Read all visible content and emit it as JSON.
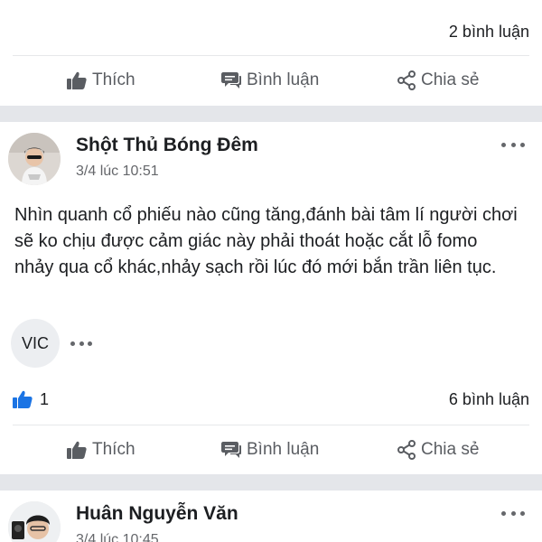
{
  "previous_post": {
    "comments": "2 bình luận",
    "actions": {
      "like": "Thích",
      "comment": "Bình luận",
      "share": "Chia sẻ"
    }
  },
  "post": {
    "author": "Shột Thủ Bóng Đêm",
    "time": "3/4 lúc 10:51",
    "text": "Nhìn quanh cổ phiếu nào cũng tăng,đánh bài tâm lí người chơi sẽ ko chịu được cảm giác này phải thoát hoặc cắt lỗ fomo nhảy qua cổ khác,nhảy sạch rồi lúc đó mới bắn trần liên tục.",
    "tag": "VIC",
    "likes": "1",
    "comments": "6 bình luận",
    "actions": {
      "like": "Thích",
      "comment": "Bình luận",
      "share": "Chia sẻ"
    }
  },
  "next_post": {
    "author": "Huân Nguyễn Văn",
    "time": "3/4 lúc 10:45"
  },
  "colors": {
    "accent": "#1b74e4",
    "text": "#1c1e21",
    "muted": "#65676b",
    "separator": "#e4e6ea"
  }
}
